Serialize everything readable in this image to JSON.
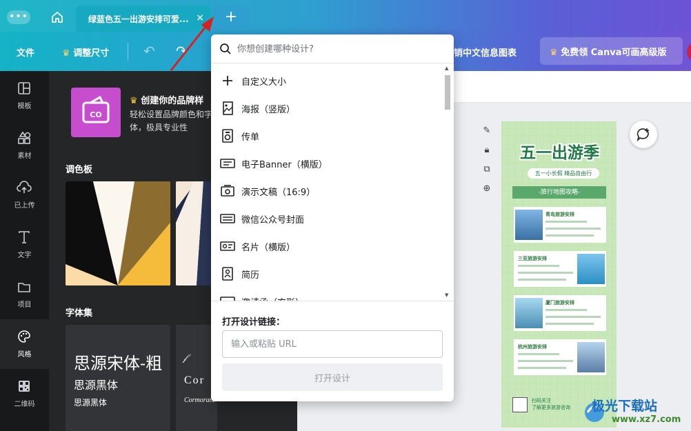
{
  "tabs": {
    "menu_glyph": "•••",
    "active_tab_label": "绿蓝色五一出游安排可爱...",
    "close_glyph": "×",
    "new_tab_glyph": "+"
  },
  "toolbar": {
    "file_label": "文件",
    "resize_label": "调整尺寸",
    "design_title": "销中文信息图表",
    "upgrade_label": "免费领 Canva可画高级版"
  },
  "sidebar": {
    "items": [
      {
        "label": "模板",
        "icon": "template-icon"
      },
      {
        "label": "素材",
        "icon": "elements-icon"
      },
      {
        "label": "已上传",
        "icon": "upload-icon"
      },
      {
        "label": "文字",
        "icon": "text-icon"
      },
      {
        "label": "项目",
        "icon": "folder-icon"
      },
      {
        "label": "风格",
        "icon": "palette-icon"
      },
      {
        "label": "二维码",
        "icon": "qrcode-icon"
      }
    ]
  },
  "panel": {
    "brand_title": "创建你的品牌样",
    "brand_desc": "轻松设置品牌颜色和字体，极具专业性",
    "palette_title": "调色板",
    "fonts_title": "字体集",
    "font1_line1": "思源宋体-粗",
    "font1_line2": "思源黑体",
    "font1_line3": "思源黑体",
    "font2_line1": "Cor",
    "font2_line2": "Cormorant Garamond Light"
  },
  "popup": {
    "search_placeholder": "你想创建哪种设计?",
    "items": [
      {
        "label": "自定义大小",
        "icon": "plus-icon"
      },
      {
        "label": "海报（竖版）",
        "icon": "poster-icon"
      },
      {
        "label": "传单",
        "icon": "flyer-icon"
      },
      {
        "label": "电子Banner（横版）",
        "icon": "banner-icon"
      },
      {
        "label": "演示文稿（16:9）",
        "icon": "presentation-icon"
      },
      {
        "label": "微信公众号封面",
        "icon": "wechat-cover-icon"
      },
      {
        "label": "名片（横版）",
        "icon": "business-card-icon"
      },
      {
        "label": "简历",
        "icon": "resume-icon"
      },
      {
        "label": "邀请函（方形）",
        "icon": "invitation-icon"
      }
    ],
    "url_label": "打开设计链接：",
    "url_placeholder": "输入或粘贴 URL",
    "open_button": "打开设计"
  },
  "poster": {
    "title": "五一出游季",
    "subtitle": "五一小长假 精品自由行",
    "band": "-旅行地图攻略-",
    "items": [
      "青岛旅游安排",
      "三亚旅游安排",
      "厦门旅游安排",
      "杭州旅游安排"
    ],
    "footer_line1": "扫码关注",
    "footer_line2": "了解更多旅游咨询"
  },
  "watermark": {
    "line1": "极光下载站",
    "line2": "www.xz7.com"
  },
  "colors": {
    "accent_teal": "#18a9c2",
    "accent_purple": "#6d52d6",
    "sidebar_bg": "#18191b",
    "panel_bg": "#252627",
    "arrow_red": "#d42323"
  }
}
